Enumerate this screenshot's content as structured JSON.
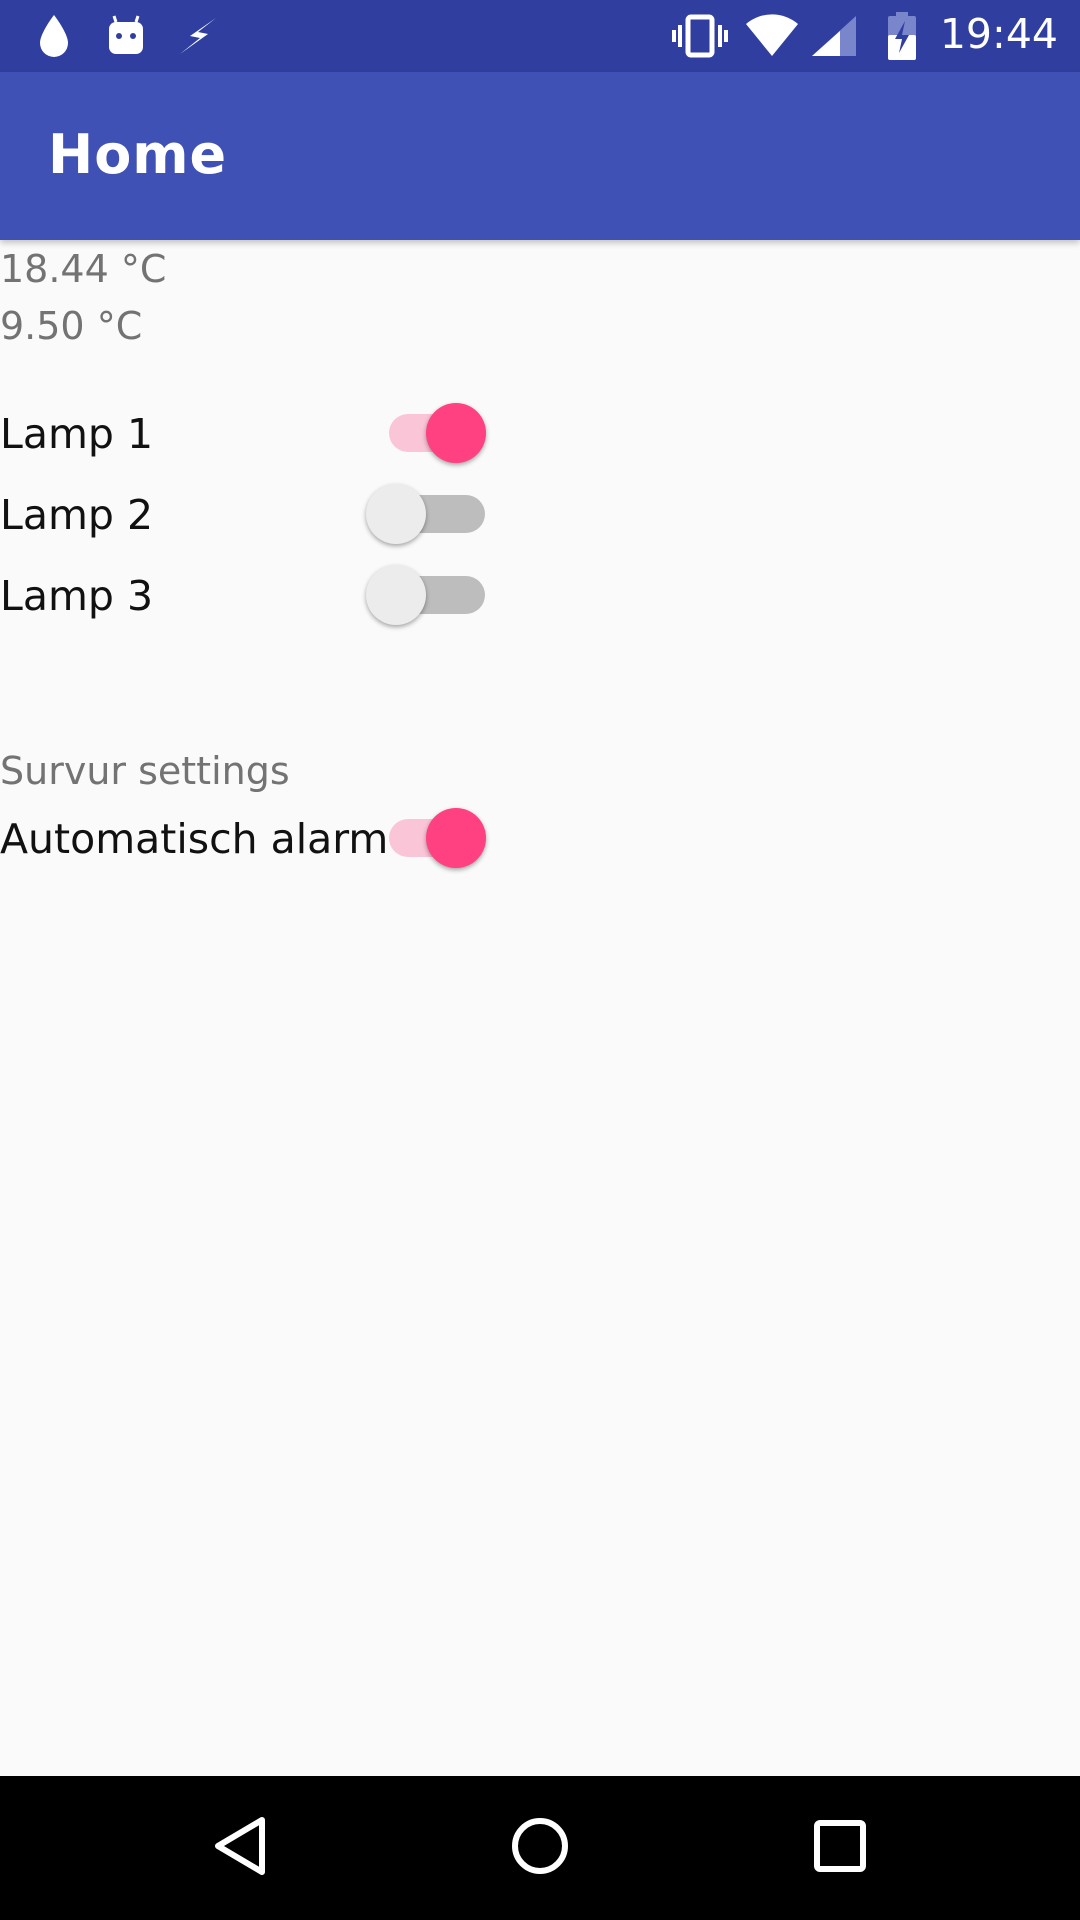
{
  "status_bar": {
    "time": "19:44",
    "icons": [
      "water-drop-icon",
      "android-icon",
      "bolt-icon",
      "vibrate-icon",
      "wifi-icon",
      "cell-signal-icon",
      "battery-charging-icon"
    ]
  },
  "app_bar": {
    "title": "Home"
  },
  "temperatures": {
    "temp1": "18.44 °C",
    "temp2": "9.50 °C"
  },
  "lamps": [
    {
      "label": "Lamp 1",
      "on": true
    },
    {
      "label": "Lamp 2",
      "on": false
    },
    {
      "label": "Lamp 3",
      "on": false
    }
  ],
  "server_settings": {
    "heading": "Survur settings",
    "auto_alarm_label": "Automatisch alarm",
    "auto_alarm_on": true
  },
  "nav_bar": {
    "icons": [
      "back-icon",
      "home-icon",
      "recents-icon"
    ]
  },
  "colors": {
    "status_bar": "#303f9f",
    "app_bar": "#3f51b5",
    "accent": "#ff4081",
    "background": "#fafafa"
  }
}
